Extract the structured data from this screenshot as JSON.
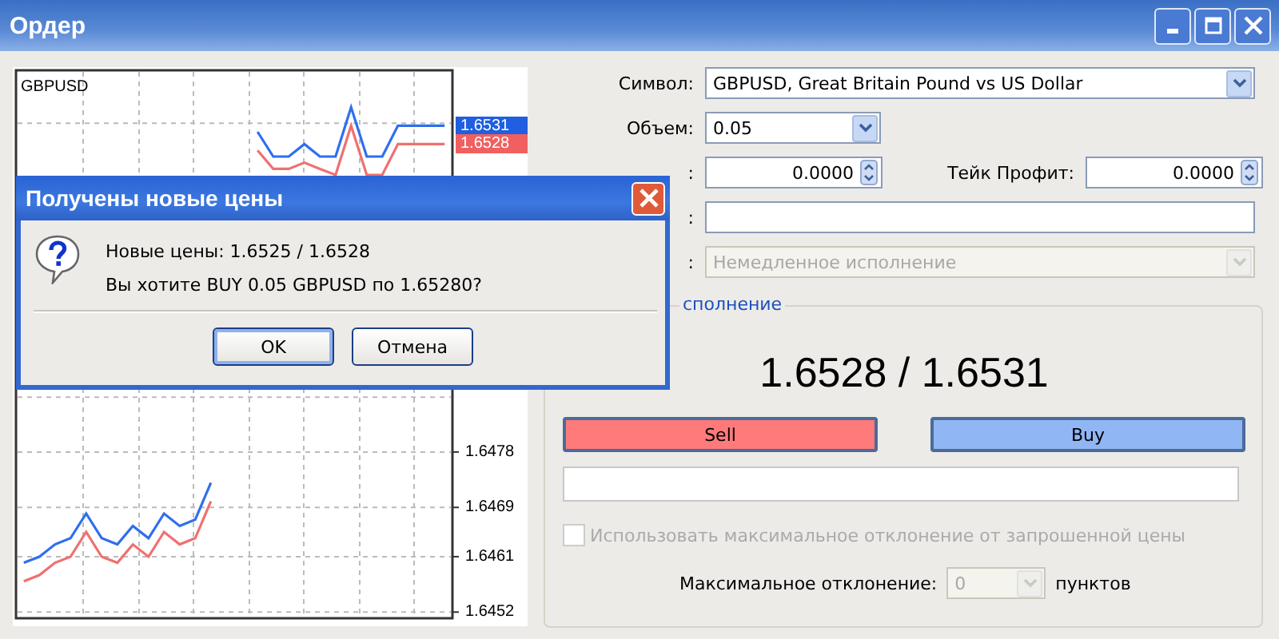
{
  "window": {
    "title": "Ордер"
  },
  "chart": {
    "symbol": "GBPUSD",
    "price_tags": [
      {
        "text": "1.6531",
        "color": "#1f5fe0"
      },
      {
        "text": "1.6528",
        "color": "#f06060"
      }
    ],
    "chart_data": {
      "type": "line",
      "grid": true,
      "ylim": [
        1.6451,
        1.654
      ],
      "yticks": [
        {
          "value": 1.6478,
          "label": "1.6478"
        },
        {
          "value": 1.6469,
          "label": "1.6469"
        },
        {
          "value": 1.6461,
          "label": "1.6461"
        },
        {
          "value": 1.6452,
          "label": "1.6452"
        }
      ],
      "series": [
        {
          "color": "#f07070",
          "values": [
            1.6457,
            1.6458,
            1.646,
            1.6461,
            1.6465,
            1.6461,
            1.646,
            1.6463,
            1.6461,
            1.6465,
            1.6463,
            1.6464,
            1.647,
            null,
            null,
            1.6527,
            1.6524,
            1.6524,
            1.6525,
            1.6524,
            1.6523,
            1.6531,
            1.6523,
            1.6523,
            1.6528,
            1.6528,
            1.6528,
            1.6528
          ]
        },
        {
          "color": "#2f6fee",
          "values": [
            1.646,
            1.6461,
            1.6463,
            1.6464,
            1.6468,
            1.6464,
            1.6463,
            1.6466,
            1.6464,
            1.6468,
            1.6466,
            1.6467,
            1.6473,
            null,
            null,
            1.653,
            1.6526,
            1.6526,
            1.6528,
            1.6526,
            1.6526,
            1.6534,
            1.6526,
            1.6526,
            1.6531,
            1.6531,
            1.6531,
            1.6531
          ]
        }
      ]
    }
  },
  "form": {
    "symbol_label": "Символ:",
    "symbol_value": "GBPUSD, Great Britain Pound vs US Dollar",
    "volume_label": "Объем:",
    "volume_value": "0.05",
    "stop_loss_label": ":",
    "stop_loss_value": "0.0000",
    "take_profit_label": "Тейк Профит:",
    "take_profit_value": "0.0000",
    "comment_label": ":",
    "type_label": ":",
    "type_value": "Немедленное исполнение",
    "type_disabled": true
  },
  "execution": {
    "group_title": "сполнение",
    "quote": "1.6528 / 1.6531",
    "sell": "Sell",
    "buy": "Buy",
    "deviation_check": {
      "label": "Использовать максимальное отклонение от запрошенной цены",
      "checked": false,
      "disabled": true
    },
    "deviation_label": "Максимальное отклонение:",
    "deviation_value": "0",
    "deviation_unit": "пунктов"
  },
  "dialog": {
    "title": "Получены новые цены",
    "lines": [
      "Новые цены: 1.6525 / 1.6528",
      "Вы хотите BUY 0.05 GBPUSD по 1.65280?"
    ],
    "buttons": [
      {
        "label": "OK",
        "selected": true
      },
      {
        "label": "Отмена",
        "selected": false
      }
    ]
  }
}
